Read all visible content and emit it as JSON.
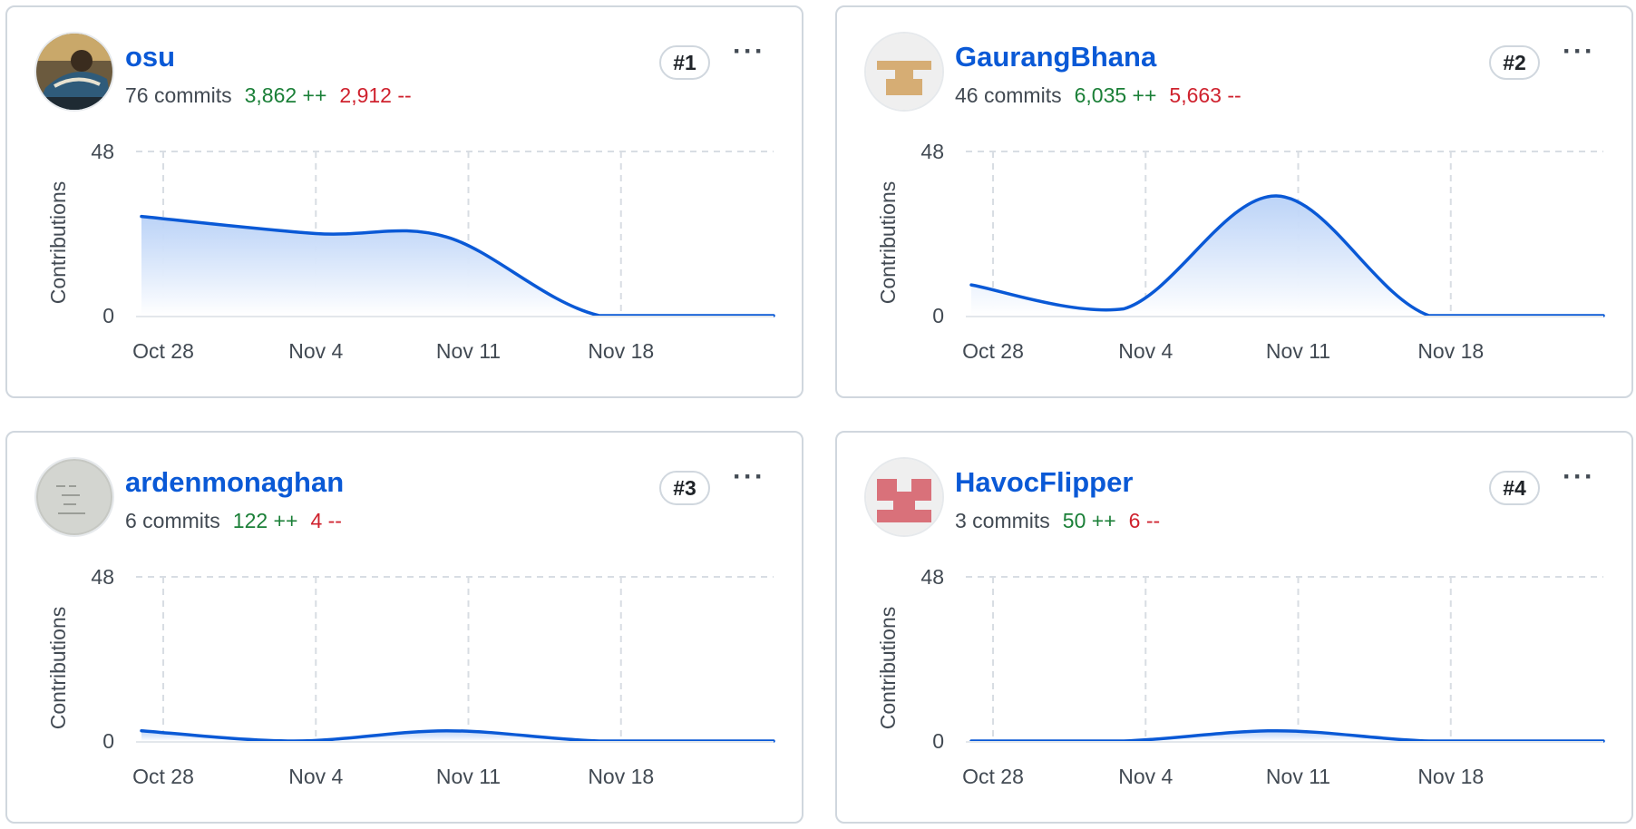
{
  "contributors": [
    {
      "username": "osu",
      "commits": "76 commits",
      "additions": "3,862 ++",
      "deletions": "2,912 --",
      "rank": "#1",
      "menu_icon": "kebab-horizontal-icon",
      "avatar": "photo-avatar"
    },
    {
      "username": "GaurangBhana",
      "commits": "46 commits",
      "additions": "6,035 ++",
      "deletions": "5,663 --",
      "rank": "#2",
      "menu_icon": "kebab-horizontal-icon",
      "avatar": "identicon-avatar",
      "avatar_color": "#d6ad74"
    },
    {
      "username": "ardenmonaghan",
      "commits": "6 commits",
      "additions": "122 ++",
      "deletions": "4 --",
      "rank": "#3",
      "menu_icon": "kebab-horizontal-icon",
      "avatar": "photo-avatar"
    },
    {
      "username": "HavocFlipper",
      "commits": "3 commits",
      "additions": "50 ++",
      "deletions": "6 --",
      "rank": "#4",
      "menu_icon": "kebab-horizontal-icon",
      "avatar": "identicon-avatar",
      "avatar_color": "#d9717a"
    }
  ],
  "colors": {
    "line": "#0a59d6",
    "area_top": "#b8d1f7",
    "area_bottom": "#ffffff",
    "grid": "#d8dde3",
    "axis_text": "#424a53",
    "link": "#0a59d6",
    "additions": "#1a7f37",
    "deletions": "#cf222e"
  },
  "chart_data": [
    {
      "type": "area",
      "title": "",
      "ylabel": "Contributions",
      "ylim": [
        0,
        48
      ],
      "yticks": [
        "0",
        "48"
      ],
      "xticks": [
        "Oct 28",
        "Nov 4",
        "Nov 11",
        "Nov 18"
      ],
      "x": [
        "Oct 27",
        "Nov 4",
        "Nov 10",
        "Nov 17",
        "Nov 25"
      ],
      "series": [
        {
          "values": [
            29,
            24,
            23,
            0,
            0
          ]
        }
      ],
      "grid": true
    },
    {
      "type": "area",
      "title": "",
      "ylabel": "Contributions",
      "ylim": [
        0,
        48
      ],
      "yticks": [
        "0",
        "48"
      ],
      "xticks": [
        "Oct 28",
        "Nov 4",
        "Nov 11",
        "Nov 18"
      ],
      "x": [
        "Oct 27",
        "Nov 3",
        "Nov 10",
        "Nov 17",
        "Nov 25"
      ],
      "series": [
        {
          "values": [
            9,
            2,
            35,
            0,
            0
          ]
        }
      ],
      "grid": true
    },
    {
      "type": "area",
      "title": "",
      "ylabel": "Contributions",
      "ylim": [
        0,
        48
      ],
      "yticks": [
        "0",
        "48"
      ],
      "xticks": [
        "Oct 28",
        "Nov 4",
        "Nov 11",
        "Nov 18"
      ],
      "x": [
        "Oct 27",
        "Nov 3",
        "Nov 10",
        "Nov 17",
        "Nov 25"
      ],
      "series": [
        {
          "values": [
            3,
            0,
            3,
            0,
            0
          ]
        }
      ],
      "grid": true
    },
    {
      "type": "area",
      "title": "",
      "ylabel": "Contributions",
      "ylim": [
        0,
        48
      ],
      "yticks": [
        "0",
        "48"
      ],
      "xticks": [
        "Oct 28",
        "Nov 4",
        "Nov 11",
        "Nov 18"
      ],
      "x": [
        "Oct 27",
        "Nov 3",
        "Nov 10",
        "Nov 17",
        "Nov 25"
      ],
      "series": [
        {
          "values": [
            0,
            0,
            3,
            0,
            0
          ]
        }
      ],
      "grid": true
    }
  ]
}
